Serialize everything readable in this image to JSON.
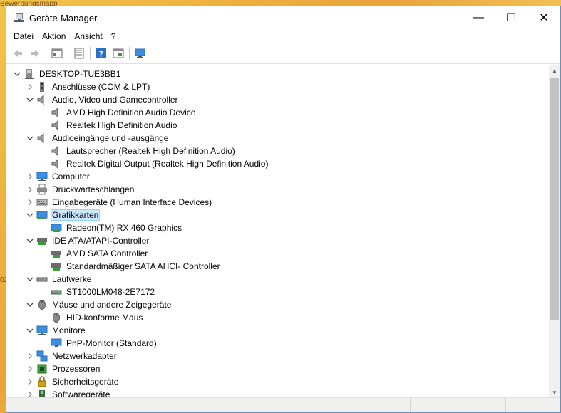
{
  "background": {
    "text_top": "Bewerbungsmapp",
    "text_side": "02"
  },
  "window": {
    "title": "Geräte-Manager",
    "title_icon": "device-manager-icon",
    "buttons": {
      "minimize": "—",
      "maximize": "☐",
      "close": "✕"
    }
  },
  "menu": [
    "Datei",
    "Aktion",
    "Ansicht",
    "?"
  ],
  "toolbar": [
    "back",
    "forward",
    "show-hide-tree",
    "properties",
    "help",
    "run-action",
    "scan-hardware"
  ],
  "tree": {
    "root": "DESKTOP-TUE3BB1",
    "nodes": [
      {
        "label": "Anschlüsse (COM & LPT)",
        "expanded": false,
        "icon": "port-icon",
        "children": []
      },
      {
        "label": "Audio, Video und Gamecontroller",
        "expanded": true,
        "icon": "speaker-icon",
        "children": [
          {
            "label": "AMD High Definition Audio Device",
            "icon": "speaker-icon"
          },
          {
            "label": "Realtek High Definition Audio",
            "icon": "speaker-icon"
          }
        ]
      },
      {
        "label": "Audioeingänge und -ausgänge",
        "expanded": true,
        "icon": "speaker-icon",
        "children": [
          {
            "label": "Lautsprecher (Realtek High Definition Audio)",
            "icon": "speaker-icon"
          },
          {
            "label": "Realtek Digital Output (Realtek High Definition Audio)",
            "icon": "speaker-icon"
          }
        ]
      },
      {
        "label": "Computer",
        "expanded": false,
        "icon": "computer-icon",
        "children": []
      },
      {
        "label": "Druckwarteschlangen",
        "expanded": false,
        "icon": "printer-icon",
        "children": []
      },
      {
        "label": "Eingabegeräte (Human Interface Devices)",
        "expanded": false,
        "icon": "keyboard-icon",
        "children": []
      },
      {
        "label": "Grafikkarten",
        "expanded": true,
        "selected": true,
        "icon": "display-adapter-icon",
        "children": [
          {
            "label": "Radeon(TM) RX 460 Graphics",
            "icon": "display-adapter-icon"
          }
        ]
      },
      {
        "label": "IDE ATA/ATAPI-Controller",
        "expanded": true,
        "icon": "controller-icon",
        "children": [
          {
            "label": "AMD SATA Controller",
            "icon": "controller-icon"
          },
          {
            "label": "Standardmäßiger SATA AHCI- Controller",
            "icon": "controller-icon"
          }
        ]
      },
      {
        "label": "Laufwerke",
        "expanded": true,
        "icon": "drive-icon",
        "children": [
          {
            "label": "ST1000LM048-2E7172",
            "icon": "drive-icon"
          }
        ]
      },
      {
        "label": "Mäuse und andere Zeigegeräte",
        "expanded": true,
        "icon": "mouse-icon",
        "children": [
          {
            "label": "HID-konforme Maus",
            "icon": "mouse-icon"
          }
        ]
      },
      {
        "label": "Monitore",
        "expanded": true,
        "icon": "monitor-icon",
        "children": [
          {
            "label": "PnP-Monitor (Standard)",
            "icon": "monitor-icon"
          }
        ]
      },
      {
        "label": "Netzwerkadapter",
        "expanded": false,
        "icon": "network-icon",
        "children": []
      },
      {
        "label": "Prozessoren",
        "expanded": false,
        "icon": "processor-icon",
        "children": []
      },
      {
        "label": "Sicherheitsgeräte",
        "expanded": false,
        "icon": "security-icon",
        "children": []
      },
      {
        "label": "Softwaregeräte",
        "expanded": false,
        "icon": "software-device-icon",
        "children": []
      }
    ]
  },
  "colors": {
    "selection": "#cce8ff",
    "selection_border": "#99d1ff",
    "accent": "#1e72c8"
  }
}
